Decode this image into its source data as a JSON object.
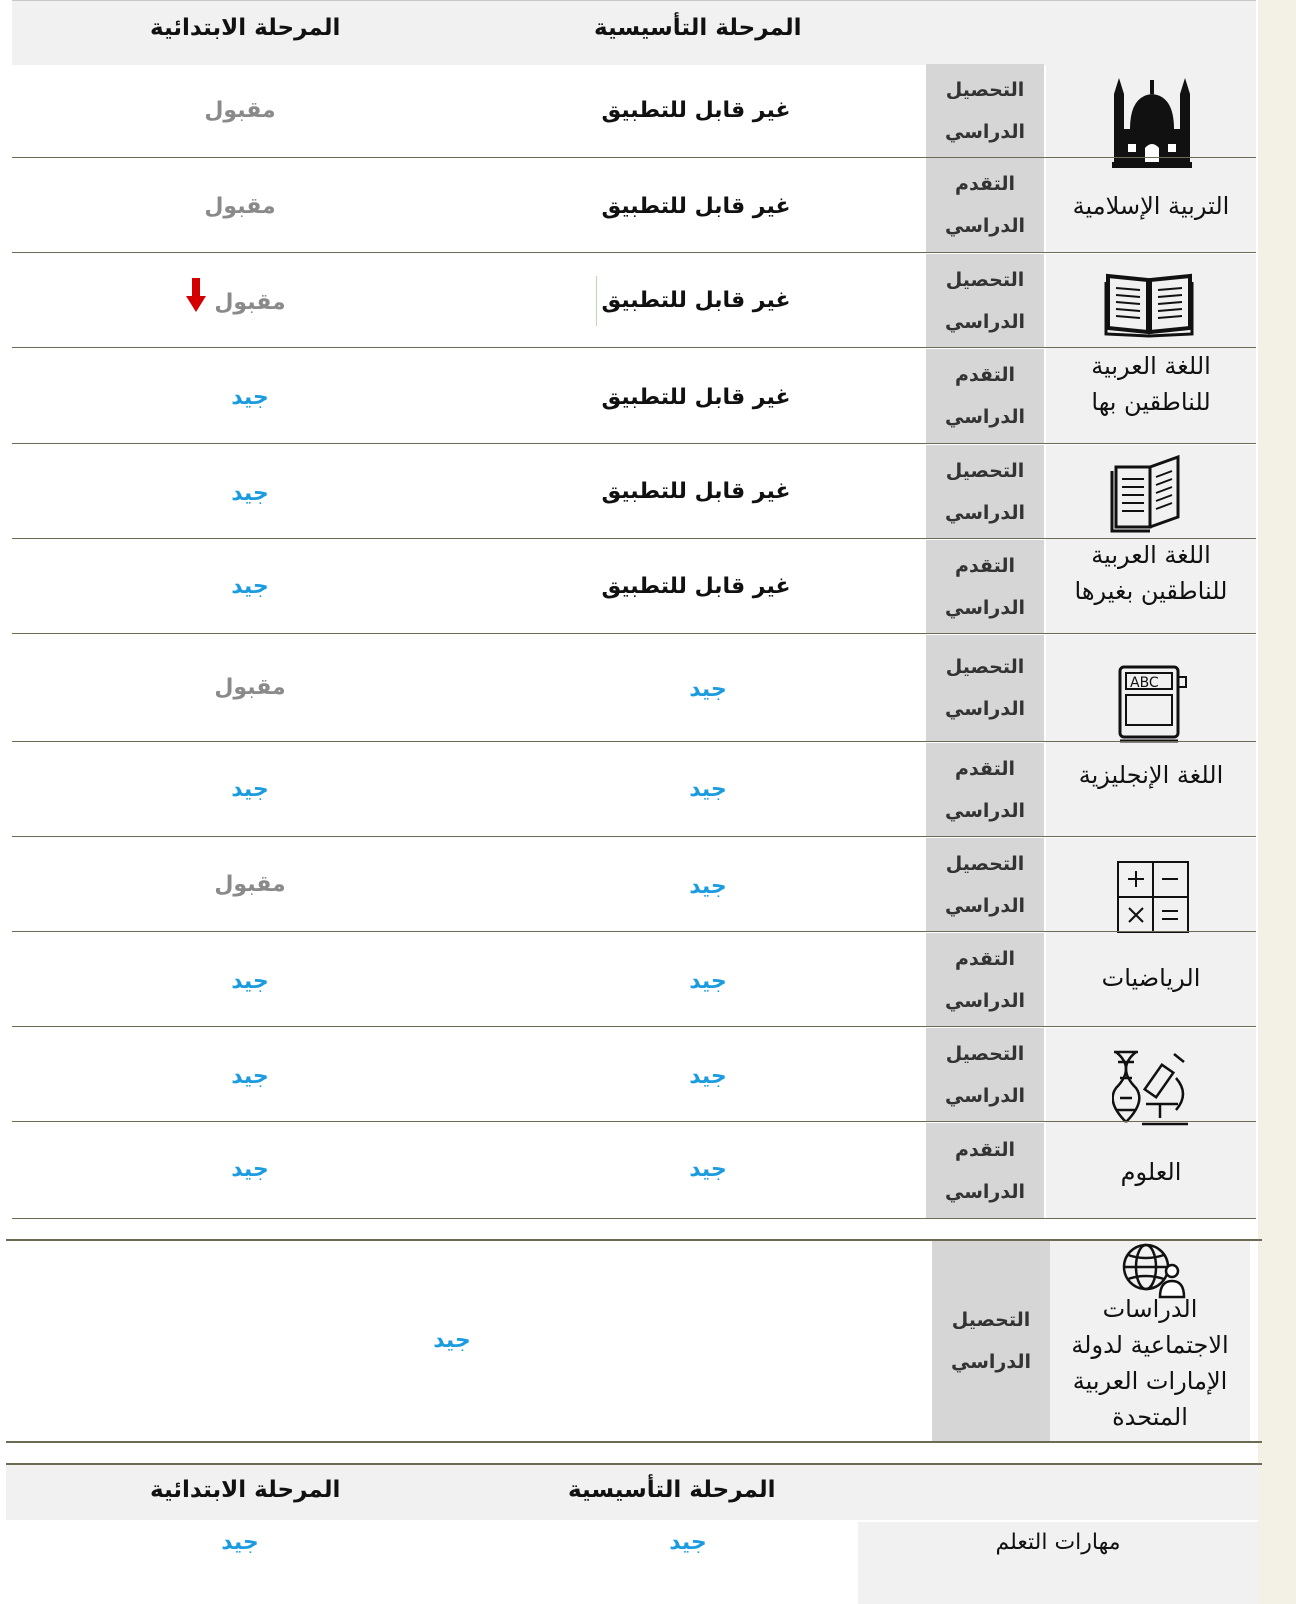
{
  "headers": {
    "foundation": "المرحلة التأسيسية",
    "primary": "المرحلة الابتدائية"
  },
  "types": {
    "achievement_line1": "التحصيل",
    "achievement_line2": "الدراسي",
    "progress_line1": "التقدم",
    "progress_line2": "الدراسي"
  },
  "subjects": [
    {
      "name_lines": [
        "التربية الإسلامية"
      ],
      "icon": "mosque-icon",
      "achievement": {
        "foundation": "غير قابل للتطبيق",
        "primary": "مقبول"
      },
      "progress": {
        "foundation": "غير قابل للتطبيق",
        "primary": "مقبول"
      }
    },
    {
      "name_lines": [
        "اللغة العربية",
        "للناطقين بها"
      ],
      "icon": "open-book-icon",
      "achievement": {
        "foundation": "غير قابل للتطبيق",
        "primary": "مقبول"
      },
      "progress": {
        "foundation": "غير قابل للتطبيق",
        "primary": "جيد"
      }
    },
    {
      "name_lines": [
        "اللغة العربية",
        "للناطقين بغيرها"
      ],
      "icon": "standing-book-icon",
      "achievement": {
        "foundation": "غير قابل للتطبيق",
        "primary": "جيد"
      },
      "progress": {
        "foundation": "غير قابل للتطبيق",
        "primary": "جيد"
      }
    },
    {
      "name_lines": [
        "اللغة الإنجليزية"
      ],
      "icon": "abc-book-icon",
      "achievement": {
        "foundation": "جيد",
        "primary": "مقبول"
      },
      "progress": {
        "foundation": "جيد",
        "primary": "جيد"
      }
    },
    {
      "name_lines": [
        "الرياضيات"
      ],
      "icon": "calculator-icon",
      "achievement": {
        "foundation": "جيد",
        "primary": "مقبول"
      },
      "progress": {
        "foundation": "جيد",
        "primary": "جيد"
      }
    },
    {
      "name_lines": [
        "العلوم"
      ],
      "icon": "dna-microscope-icon",
      "achievement": {
        "foundation": "جيد",
        "primary": "جيد"
      },
      "progress": {
        "foundation": "جيد",
        "primary": "جيد"
      }
    }
  ],
  "social_studies": {
    "name_lines": [
      "الدراسات",
      "الاجتماعية لدولة",
      "الإمارات العربية",
      "المتحدة"
    ],
    "icon": "globe-person-icon",
    "achievement": "جيد"
  },
  "learning_skills": {
    "label": "مهارات التعلم",
    "foundation": "جيد",
    "primary": "جيد"
  },
  "colors": {
    "not_applicable": "#111111",
    "acceptable": "#8a8a8a",
    "good": "#1b9ce0",
    "decline_arrow": "#d40000",
    "header_bg": "#f1f1f1",
    "type_bg": "#d6d6d6"
  },
  "indicators": {
    "decline_arrow_on": "arabic_native.achievement.primary"
  }
}
